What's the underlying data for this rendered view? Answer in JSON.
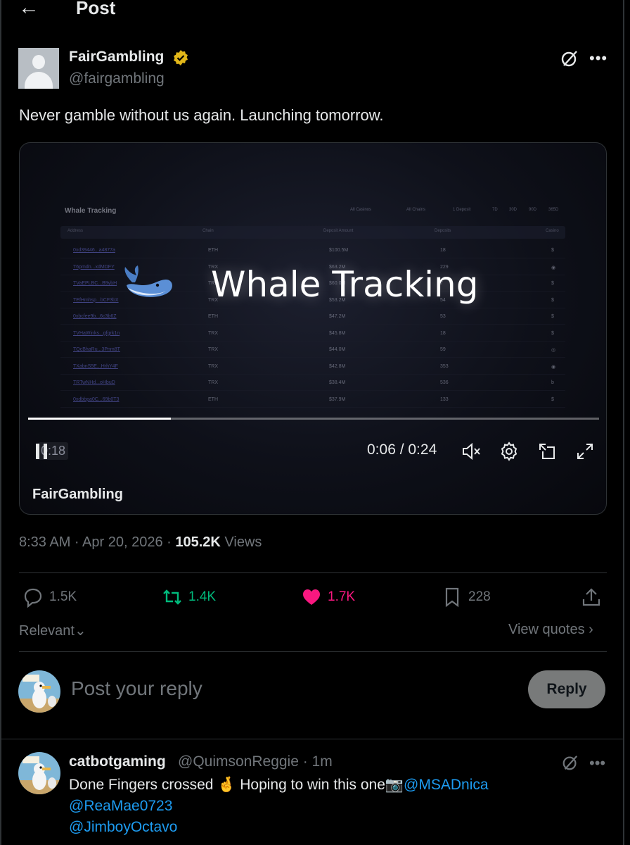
{
  "header": {
    "back_icon": "arrow-left-icon",
    "title": "Post"
  },
  "post": {
    "author_name": "FairGambling",
    "author_handle": "@fairgambling",
    "verified_color": "#e2b719",
    "text": "Never gamble without us again. Launching tomorrow.",
    "timestamp": "8:33 AM · Apr 20, 2026 · ",
    "views_count": "105.2K",
    "views_label": " Views"
  },
  "video": {
    "overlay_title": "Whale Tracking",
    "dashboard": {
      "title": "Whale Tracking",
      "filters": [
        "All Casinos",
        "All Chains",
        "1 Deposit",
        "7D",
        "30D",
        "90D",
        "365D"
      ],
      "columns": [
        "Address",
        "Chain",
        "Deposit Amount",
        "Deposits",
        "Casino"
      ],
      "rows": [
        [
          "0xd39446...a4877a",
          "ETH",
          "$100.5M",
          "18",
          "$"
        ],
        [
          "T6pmdn...xdMDFY",
          "TRX",
          "$63.2M",
          "229",
          "◉"
        ],
        [
          "TVaEPLBC...B9ybH",
          "TRX",
          "$60.0M",
          "7",
          "$"
        ],
        [
          "TEfHmhsp...bCF3bX",
          "TRX",
          "$53.2M",
          "54",
          "$"
        ],
        [
          "0xbcfee9b...6c3b6Z",
          "ETH",
          "$47.2M",
          "53",
          "$"
        ],
        [
          "TVHaWinks...gfgrk1n",
          "TRX",
          "$45.8M",
          "18",
          "$"
        ],
        [
          "TQcBhaRu...3Pnm8T",
          "TRX",
          "$44.0M",
          "59",
          "◎"
        ],
        [
          "TXabnS5E...HrhY4F",
          "TRX",
          "$42.8M",
          "353",
          "◉"
        ],
        [
          "TRTwNHd...oHbuD",
          "TRX",
          "$38.4M",
          "536",
          "b"
        ],
        [
          "0xdbbpa0C...69b0T3",
          "ETH",
          "$37.9M",
          "133",
          "$"
        ]
      ]
    },
    "progress": 0.25,
    "elapsed_badge": "0:18",
    "time": "0:06 / 0:24",
    "author_label": "FairGambling"
  },
  "actions": {
    "reply_count": "1.5K",
    "repost_count": "1.4K",
    "like_count": "1.7K",
    "bookmark_count": "228",
    "repost_color": "#00ba7c",
    "like_color": "#f91880"
  },
  "replies_bar": {
    "sort_label": "Relevant",
    "quotes_label": "View quotes"
  },
  "composer": {
    "placeholder": "Post your reply",
    "button_label": "Reply"
  },
  "reply": {
    "name": "catbotgaming",
    "handle_time": "@QuimsonReggie · 1m",
    "line1_prefix": "Done  Fingers crossed 🤞 Hoping to win this one📷",
    "mention1": "@MSADnica",
    "mention2": "@ReaMae0723",
    "mention3": "@JimboyOctavo"
  }
}
